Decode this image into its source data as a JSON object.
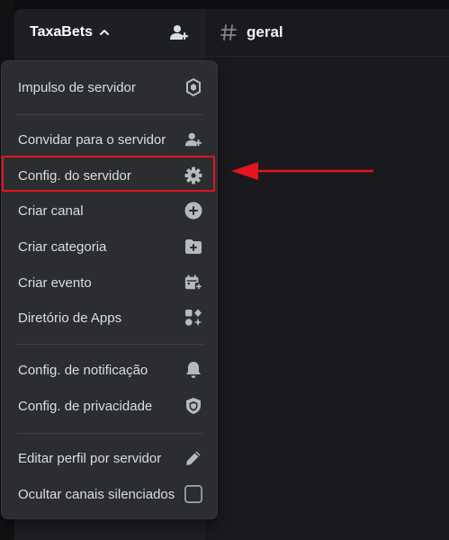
{
  "server": {
    "name": "TaxaBets"
  },
  "channel": {
    "name": "geral"
  },
  "menu": {
    "items": [
      {
        "label": "Impulso de servidor",
        "icon": "boost-gem-icon"
      },
      {
        "label": "Convidar para o servidor",
        "icon": "invite-people-icon"
      },
      {
        "label": "Config. do servidor",
        "icon": "gear-icon"
      },
      {
        "label": "Criar canal",
        "icon": "plus-circle-icon"
      },
      {
        "label": "Criar categoria",
        "icon": "folder-plus-icon"
      },
      {
        "label": "Criar evento",
        "icon": "calendar-plus-icon"
      },
      {
        "label": "Diretório de Apps",
        "icon": "apps-icon"
      },
      {
        "label": "Config. de notificação",
        "icon": "bell-icon"
      },
      {
        "label": "Config. de privacidade",
        "icon": "shield-icon"
      },
      {
        "label": "Editar perfil por servidor",
        "icon": "pencil-icon"
      },
      {
        "label": "Ocultar canais silenciados",
        "icon": "checkbox-unchecked"
      }
    ]
  },
  "annotation": {
    "highlighted_item": "Config. do servidor",
    "color": "#e3131f"
  },
  "colors": {
    "menu_bg": "#2b2d31",
    "text": "#dbdee1",
    "icon": "#b5bac1"
  }
}
